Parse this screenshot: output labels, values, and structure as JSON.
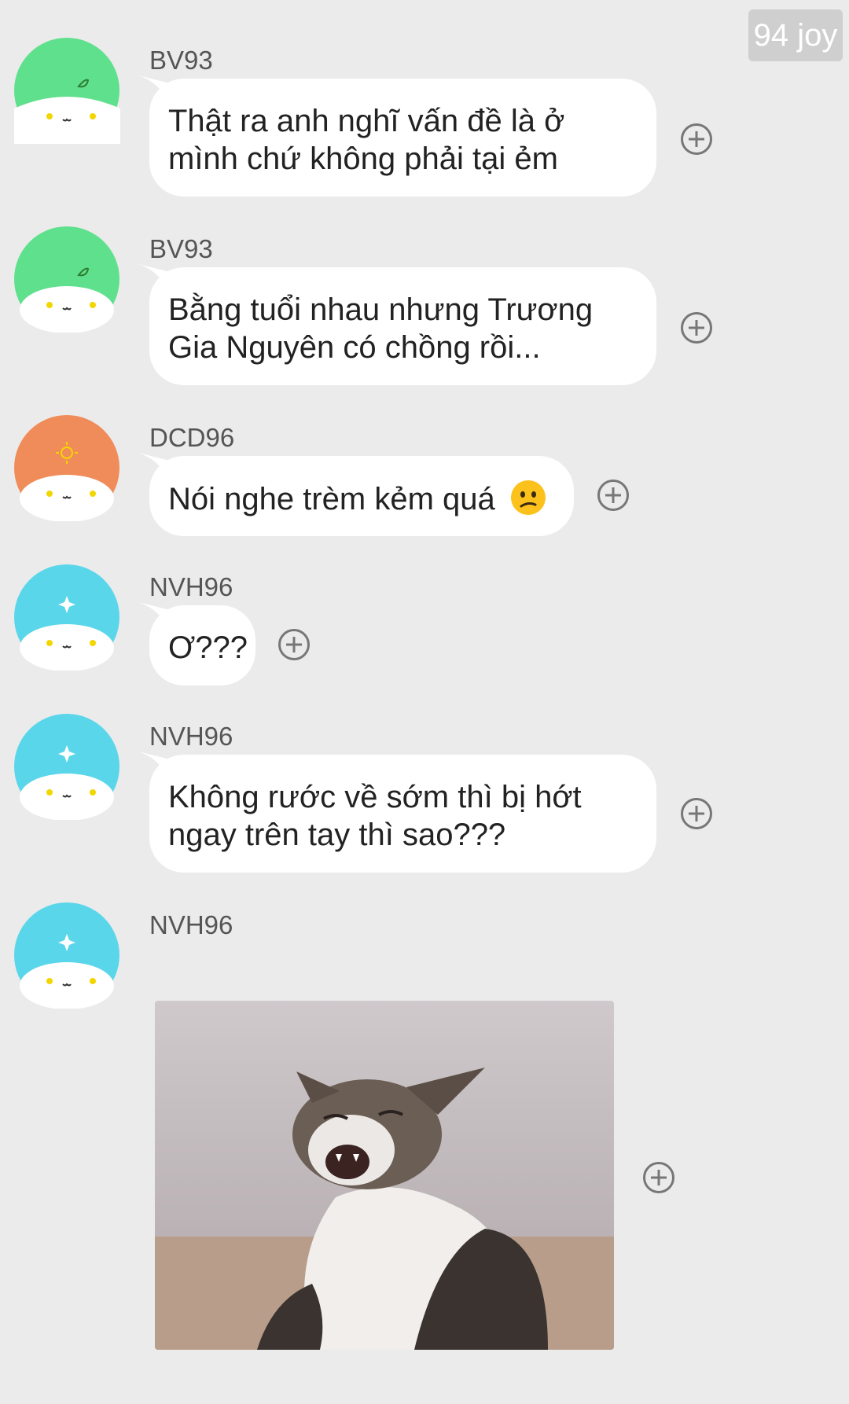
{
  "watermark": "94 joy",
  "messages": [
    {
      "sender": "BV93",
      "text_lines": [
        "Thật ra anh nghĩ vấn đề là ở",
        "mình chứ không phải tại ẻm"
      ],
      "avatar": "leaf-avatar",
      "avatar_color": "#5fe08c"
    },
    {
      "sender": "BV93",
      "text_lines": [
        "Bằng tuổi nhau nhưng Trương",
        "Gia Nguyên có chồng rồi..."
      ],
      "avatar": "leaf-avatar",
      "avatar_color": "#5fe08c"
    },
    {
      "sender": "DCD96",
      "text_lines": [
        "Nói nghe trèm kẻm quá"
      ],
      "emoji": "confused-face",
      "avatar": "sun-avatar",
      "avatar_color": "#f08c5a"
    },
    {
      "sender": "NVH96",
      "text_lines": [
        "Ơ???"
      ],
      "avatar": "sparkle-avatar",
      "avatar_color": "#5ad6ea"
    },
    {
      "sender": "NVH96",
      "text_lines": [
        "Không rước về sớm thì bị hớt",
        "ngay trên tay thì sao???"
      ],
      "avatar": "sparkle-avatar",
      "avatar_color": "#5ad6ea"
    },
    {
      "sender": "NVH96",
      "image": "screaming-cat-photo",
      "avatar": "sparkle-avatar",
      "avatar_color": "#5ad6ea"
    }
  ],
  "icons": {
    "react": "add-reaction-icon"
  }
}
